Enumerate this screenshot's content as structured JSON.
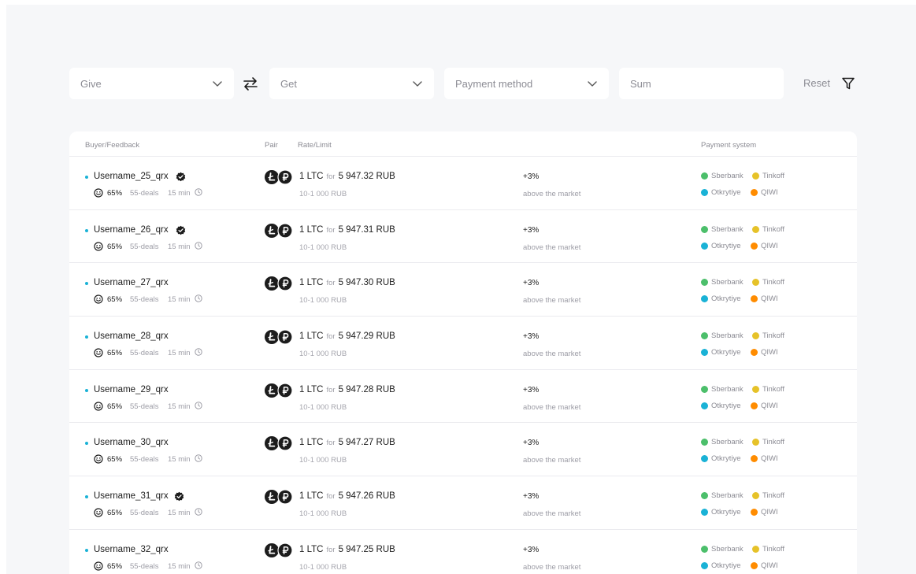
{
  "filters": {
    "give": "Give",
    "get": "Get",
    "payment_method": "Payment method",
    "sum": "Sum",
    "reset": "Reset"
  },
  "table": {
    "headers": {
      "buyer": "Buyer/Feedback",
      "pair": "Pair",
      "rate": "Rate/Limit",
      "payment": "Payment system"
    },
    "rows": [
      {
        "username": "Username_25_qrx",
        "verified": true,
        "feedback": "65%",
        "deals": "55-deals",
        "time": "15 min",
        "amount": "1 LTC",
        "for": "for",
        "price": "5 947.32 RUB",
        "limit": "10-1 000 RUB",
        "market_pct": "+3%",
        "market_text": "above the market",
        "payments": [
          "Sberbank",
          "Tinkoff",
          "Otkrytiye",
          "QIWI"
        ]
      },
      {
        "username": "Username_26_qrx",
        "verified": true,
        "feedback": "65%",
        "deals": "55-deals",
        "time": "15 min",
        "amount": "1 LTC",
        "for": "for",
        "price": "5 947.31 RUB",
        "limit": "10-1 000 RUB",
        "market_pct": "+3%",
        "market_text": "above the market",
        "payments": [
          "Sberbank",
          "Tinkoff",
          "Otkrytiye",
          "QIWI"
        ]
      },
      {
        "username": "Username_27_qrx",
        "verified": false,
        "feedback": "65%",
        "deals": "55-deals",
        "time": "15 min",
        "amount": "1 LTC",
        "for": "for",
        "price": "5 947.30 RUB",
        "limit": "10-1 000 RUB",
        "market_pct": "+3%",
        "market_text": "above the market",
        "payments": [
          "Sberbank",
          "Tinkoff",
          "Otkrytiye",
          "QIWI"
        ]
      },
      {
        "username": "Username_28_qrx",
        "verified": false,
        "feedback": "65%",
        "deals": "55-deals",
        "time": "15 min",
        "amount": "1 LTC",
        "for": "for",
        "price": "5 947.29 RUB",
        "limit": "10-1 000 RUB",
        "market_pct": "+3%",
        "market_text": "above the market",
        "payments": [
          "Sberbank",
          "Tinkoff",
          "Otkrytiye",
          "QIWI"
        ]
      },
      {
        "username": "Username_29_qrx",
        "verified": false,
        "feedback": "65%",
        "deals": "55-deals",
        "time": "15 min",
        "amount": "1 LTC",
        "for": "for",
        "price": "5 947.28 RUB",
        "limit": "10-1 000 RUB",
        "market_pct": "+3%",
        "market_text": "above the market",
        "payments": [
          "Sberbank",
          "Tinkoff",
          "Otkrytiye",
          "QIWI"
        ]
      },
      {
        "username": "Username_30_qrx",
        "verified": false,
        "feedback": "65%",
        "deals": "55-deals",
        "time": "15 min",
        "amount": "1 LTC",
        "for": "for",
        "price": "5 947.27 RUB",
        "limit": "10-1 000 RUB",
        "market_pct": "+3%",
        "market_text": "above the market",
        "payments": [
          "Sberbank",
          "Tinkoff",
          "Otkrytiye",
          "QIWI"
        ]
      },
      {
        "username": "Username_31_qrx",
        "verified": true,
        "feedback": "65%",
        "deals": "55-deals",
        "time": "15 min",
        "amount": "1 LTC",
        "for": "for",
        "price": "5 947.26 RUB",
        "limit": "10-1 000 RUB",
        "market_pct": "+3%",
        "market_text": "above the market",
        "payments": [
          "Sberbank",
          "Tinkoff",
          "Otkrytiye",
          "QIWI"
        ]
      },
      {
        "username": "Username_32_qrx",
        "verified": false,
        "feedback": "65%",
        "deals": "55-deals",
        "time": "15 min",
        "amount": "1 LTC",
        "for": "for",
        "price": "5 947.25 RUB",
        "limit": "10-1 000 RUB",
        "market_pct": "+3%",
        "market_text": "above the market",
        "payments": [
          "Sberbank",
          "Tinkoff",
          "Otkrytiye",
          "QIWI"
        ]
      }
    ]
  },
  "icons": {
    "chevron": "chevron-down-icon",
    "swap": "swap-arrows-icon",
    "filter": "filter-funnel-icon",
    "verified": "verified-badge-icon",
    "smile": "smile-icon",
    "clock": "clock-icon",
    "coins": "coin-pair-icon"
  },
  "colors": {
    "online_dot": "#1ab2d6",
    "sberbank": "#4cbf6b",
    "tinkoff": "#e6c229",
    "otkrytiye": "#1ab2d6",
    "qiwi": "#ff8c00"
  }
}
